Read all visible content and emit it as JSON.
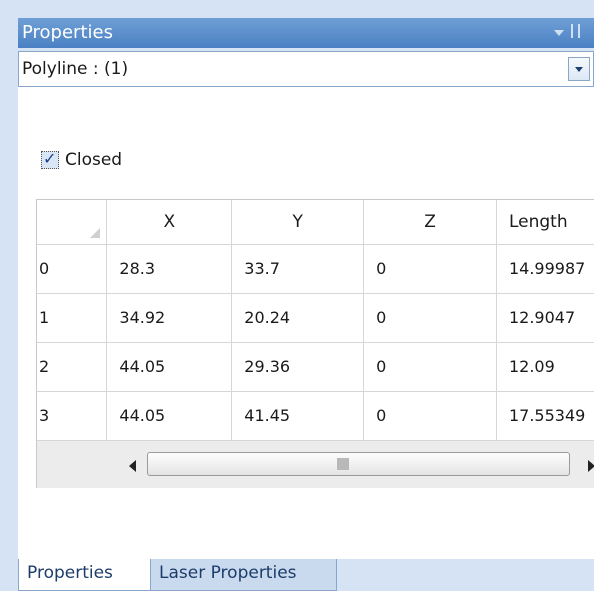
{
  "panel": {
    "title": "Properties",
    "selector_value": "Polyline : (1)"
  },
  "closed": {
    "label": "Closed",
    "checked": true
  },
  "grid": {
    "columns": [
      "X",
      "Y",
      "Z",
      "Length"
    ],
    "rows": [
      {
        "index": "0",
        "x": "28.3",
        "y": "33.7",
        "z": "0",
        "length": "14.99987"
      },
      {
        "index": "1",
        "x": "34.92",
        "y": "20.24",
        "z": "0",
        "length": "12.9047"
      },
      {
        "index": "2",
        "x": "44.05",
        "y": "29.36",
        "z": "0",
        "length": "12.09"
      },
      {
        "index": "3",
        "x": "44.05",
        "y": "41.45",
        "z": "0",
        "length": "17.55349"
      }
    ]
  },
  "tabs": [
    "Properties",
    "Laser Properties"
  ],
  "colors": {
    "titlebar": "#4a80c3",
    "background": "#d5e3f4"
  },
  "icons": [
    "dropdown-arrow-icon",
    "pin-icon",
    "checkbox-check-icon",
    "scroll-left-icon",
    "scroll-right-icon"
  ]
}
